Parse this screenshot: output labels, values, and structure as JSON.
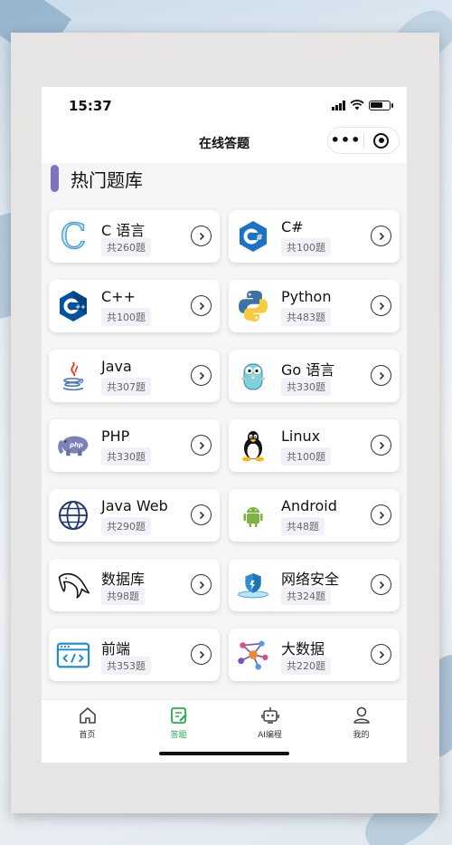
{
  "status": {
    "time": "15:37"
  },
  "nav": {
    "title": "在线答题",
    "more_label": "•••"
  },
  "section": {
    "title": "热门题库"
  },
  "banks": [
    {
      "name": "C 语言",
      "count": "共260题",
      "icon": "c-language-icon"
    },
    {
      "name": "C#",
      "count": "共100题",
      "icon": "csharp-icon"
    },
    {
      "name": "C++",
      "count": "共100题",
      "icon": "cpp-icon"
    },
    {
      "name": "Python",
      "count": "共483题",
      "icon": "python-icon"
    },
    {
      "name": "Java",
      "count": "共307题",
      "icon": "java-icon"
    },
    {
      "name": "Go 语言",
      "count": "共330题",
      "icon": "go-gopher-icon"
    },
    {
      "name": "PHP",
      "count": "共330题",
      "icon": "php-elephant-icon"
    },
    {
      "name": "Linux",
      "count": "共100题",
      "icon": "linux-tux-icon"
    },
    {
      "name": "Java Web",
      "count": "共290题",
      "icon": "globe-icon"
    },
    {
      "name": "Android",
      "count": "共48题",
      "icon": "android-icon"
    },
    {
      "name": "数据库",
      "count": "共98题",
      "icon": "dolphin-icon"
    },
    {
      "name": "网络安全",
      "count": "共324题",
      "icon": "shield-icon"
    },
    {
      "name": "前端",
      "count": "共353题",
      "icon": "code-window-icon"
    },
    {
      "name": "大数据",
      "count": "共220题",
      "icon": "network-graph-icon"
    }
  ],
  "tabs": [
    {
      "label": "首页",
      "icon": "house-icon"
    },
    {
      "label": "答题",
      "icon": "edit-icon",
      "active": true
    },
    {
      "label": "AI编程",
      "icon": "robot-icon"
    },
    {
      "label": "我的",
      "icon": "user-icon"
    }
  ],
  "colors": {
    "accent_bar": "#7c74c0",
    "tab_active": "#22b04b"
  }
}
